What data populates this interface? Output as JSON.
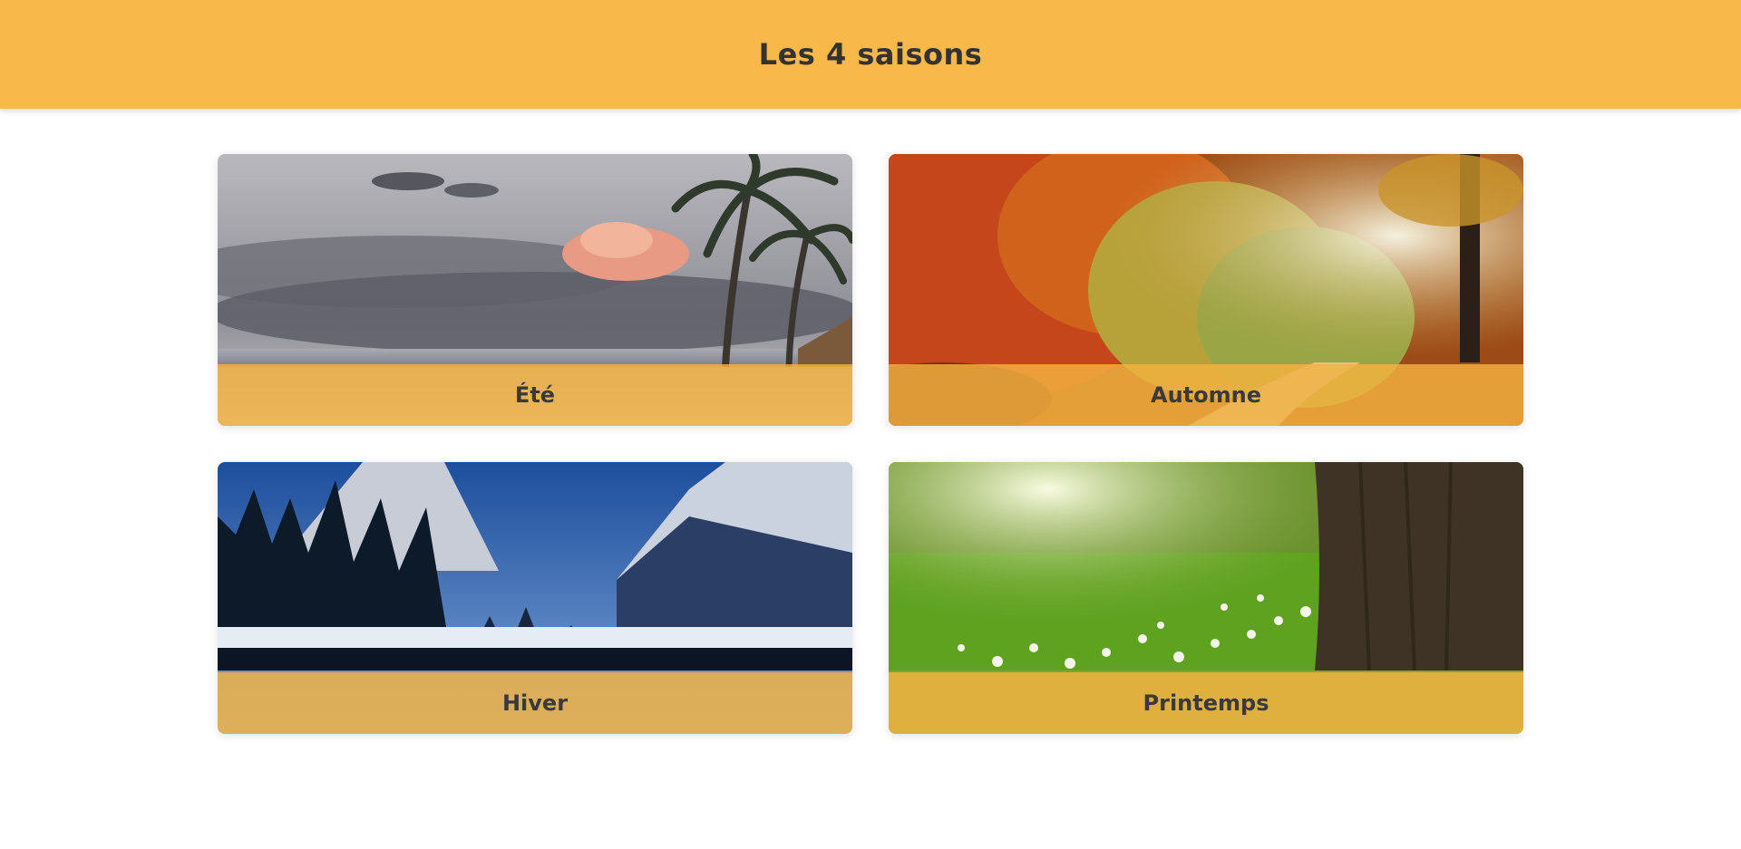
{
  "header": {
    "title": "Les 4 saisons"
  },
  "colors": {
    "header_bg": "#f8b84a",
    "label_bg": "#f4b240",
    "text": "#333333"
  },
  "seasons": [
    {
      "label": "Été",
      "image": "summer-beach-palm-trees"
    },
    {
      "label": "Automne",
      "image": "autumn-forest-path"
    },
    {
      "label": "Hiver",
      "image": "winter-mountain-valley"
    },
    {
      "label": "Printemps",
      "image": "spring-meadow-flowers"
    }
  ]
}
